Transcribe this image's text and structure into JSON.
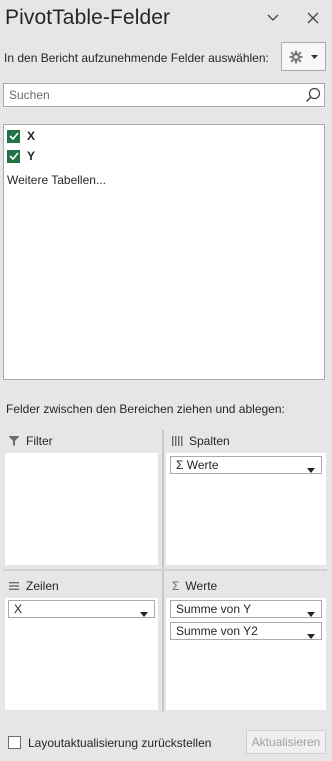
{
  "panel": {
    "title": "PivotTable-Felder",
    "choose_fields_label": "In den Bericht aufzunehmende Felder auswählen:"
  },
  "search": {
    "placeholder": "Suchen"
  },
  "fields": [
    {
      "label": "X",
      "checked": true
    },
    {
      "label": "Y",
      "checked": true
    }
  ],
  "more_tables_label": "Weitere Tabellen...",
  "drag_hint": "Felder zwischen den Bereichen ziehen und ablegen:",
  "areas": {
    "filter": {
      "title": "Filter",
      "items": []
    },
    "columns": {
      "title": "Spalten",
      "items": [
        "Σ  Werte"
      ]
    },
    "rows": {
      "title": "Zeilen",
      "items": [
        "X"
      ]
    },
    "values": {
      "title": "Werte",
      "items": [
        "Summe von Y",
        "Summe von Y2"
      ]
    }
  },
  "footer": {
    "defer_label": "Layoutaktualisierung zurückstellen",
    "defer_checked": false,
    "update_button": "Aktualisieren"
  },
  "colors": {
    "accent": "#217346",
    "panel_bg": "#e6e6e6",
    "border": "#ababab"
  }
}
